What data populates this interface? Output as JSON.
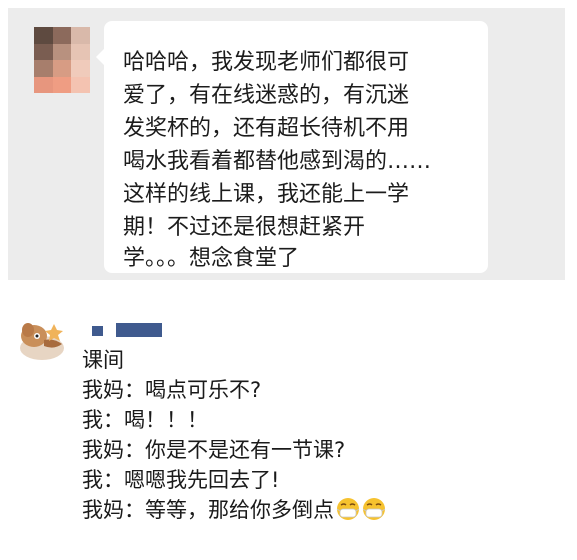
{
  "chat_message": {
    "lines": [
      "哈哈哈，我发现老师们都很可",
      "爱了，有在线迷惑的，有沉迷",
      "发奖杯的，还有超长待机不用",
      "喝水我看着都替他感到渴的……",
      "这样的线上课，我还能上一学",
      "期！不过还是很想赶紧开",
      "学。。。想念食堂了"
    ]
  },
  "comment": {
    "lines": [
      "课间",
      "我妈：喝点可乐不?",
      "我：喝！！！",
      "我妈：你是不是还有一节课?",
      "我：嗯嗯我先回去了!",
      "我妈：等等，那给你多倒点"
    ],
    "trailing_emoji": [
      "mask-face-emoji",
      "mask-face-emoji"
    ]
  },
  "colors": {
    "chat_background": "#ececec",
    "bubble_background": "#ffffff",
    "name_mask": "#3f5a8e",
    "text": "#1a1a1a"
  }
}
